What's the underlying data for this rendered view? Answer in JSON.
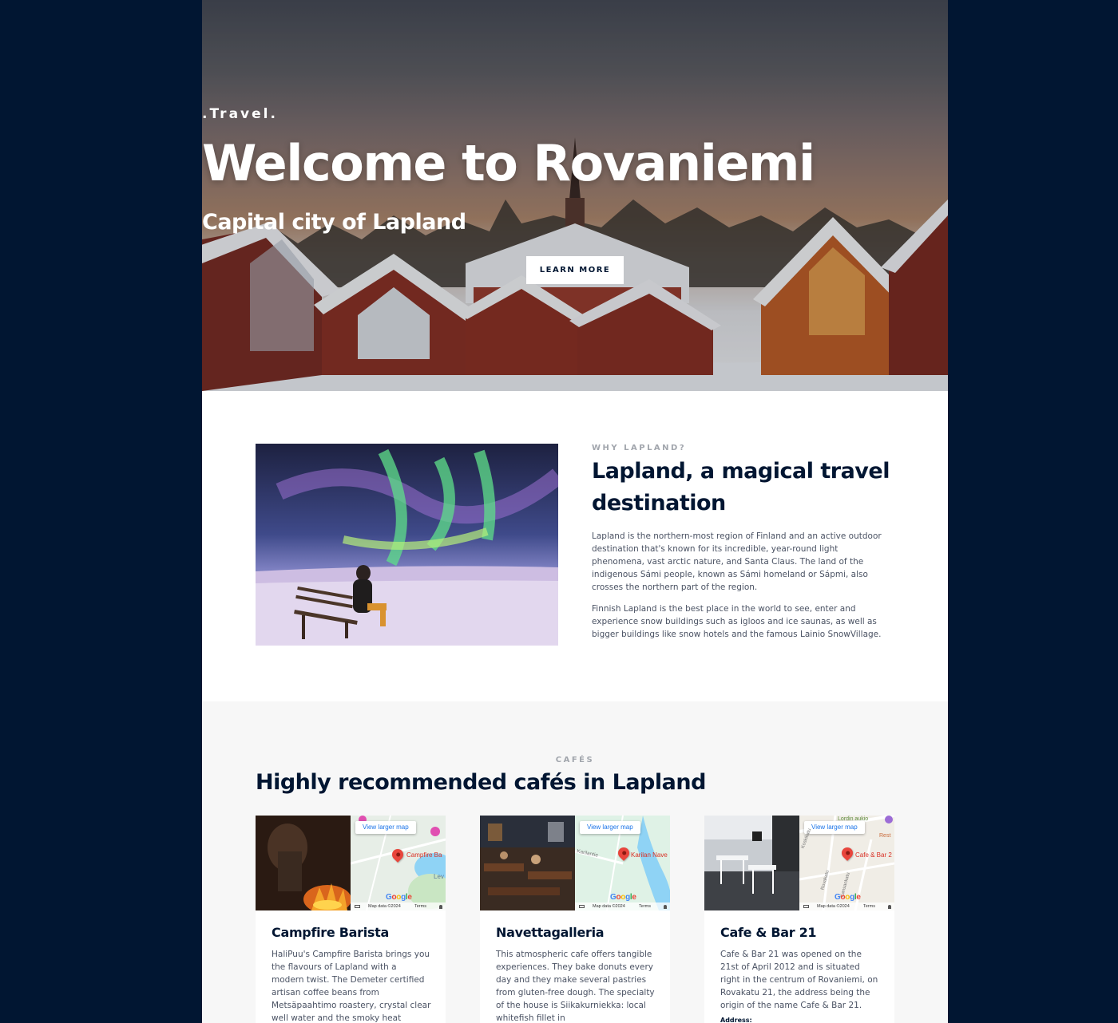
{
  "hero": {
    "tag": ".Travel.",
    "title": "Welcome to Rovaniemi",
    "subtitle": "Capital city of Lapland",
    "button_label": "LEARN MORE"
  },
  "about": {
    "eyebrow": "WHY LAPLAND?",
    "title": "Lapland, a magical travel destination",
    "paragraphs": [
      "Lapland is the northern-most region of Finland and an active outdoor destination that's known for its incredible, year-round light phenomena, vast arctic nature, and Santa Claus. The land of the indigenous Sámi people, known as Sámi homeland or Sápmi, also crosses the northern part of the region.",
      "Finnish Lapland is the best place in the world to see, enter and experience snow buildings such as igloos and ice saunas, as well as bigger buildings like snow hotels and the famous Lainio SnowVillage."
    ]
  },
  "cafes": {
    "eyebrow": "CAFÉS",
    "title": "Highly recommended cafés in Lapland",
    "map_button": "View larger map",
    "map_data": "Map data ©2024",
    "map_terms": "Terms",
    "google": "Google",
    "items": [
      {
        "name": "Campfire Barista",
        "map_label": "Campfire Ba",
        "map_extra": "Lev",
        "description": "HaliPuu's Campfire Barista brings you the flavours of Lapland with a modern twist. The Demeter certified artisan coffee beans from Metsäpaahtimo roastery, crystal clear well water and the smoky heat",
        "extra": ""
      },
      {
        "name": "Navettagalleria",
        "map_label": "Karilan Nave",
        "map_extra": "Karilantie",
        "description": "This atmospheric cafe offers tangible experiences. They bake donuts every day and they make several pastries from gluten-free dough. The specialty of the house is Siikakurniekka: local whitefish fillet in",
        "extra": ""
      },
      {
        "name": "Cafe & Bar 21",
        "map_label": "Cafe & Bar 2",
        "map_extra": "Lordin aukio",
        "map_extra2": "Rest",
        "map_street1": "Koskikatu",
        "map_street2": "Rovakatu",
        "map_street3": "Kansankatu",
        "description": "Cafe & Bar 21 was opened on the 21st of April 2012 and is situated right in the centrum of Rovaniemi, on Rovakatu 21, the address being the origin of the name Cafe & Bar 21.",
        "extra": "Address:"
      }
    ]
  }
}
